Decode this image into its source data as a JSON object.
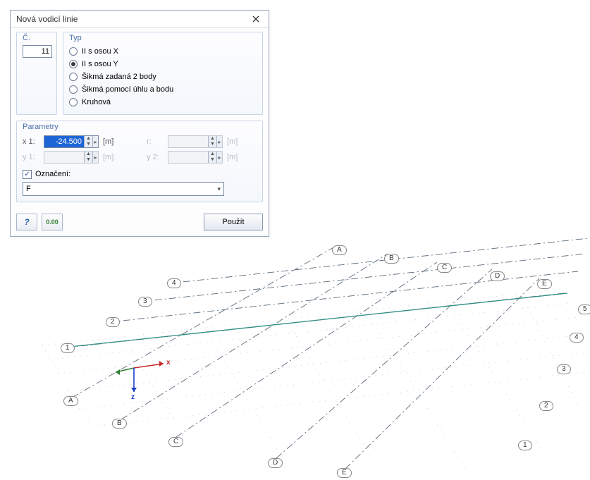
{
  "dialog": {
    "title": "Nová vodicí linie",
    "num": {
      "title": "Č.",
      "value": "11"
    },
    "type": {
      "title": "Typ",
      "options": [
        {
          "id": "opt-x",
          "label": "II s osou X",
          "checked": false
        },
        {
          "id": "opt-y",
          "label": "II s osou Y",
          "checked": true
        },
        {
          "id": "opt-2b",
          "label": "Šikmá zadaná 2 body",
          "checked": false
        },
        {
          "id": "opt-ang",
          "label": "Šikmá pomocí úhlu a bodu",
          "checked": false
        },
        {
          "id": "opt-circ",
          "label": "Kruhová",
          "checked": false
        }
      ]
    },
    "params": {
      "title": "Parametry",
      "x1": {
        "label": "x 1:",
        "value": "-24.500",
        "unit": "[m]"
      },
      "r": {
        "label": "r:",
        "value": "",
        "unit": "[m]"
      },
      "y1": {
        "label": "y 1:",
        "value": "",
        "unit": "[m]"
      },
      "y2": {
        "label": "y 2:",
        "value": "",
        "unit": "[m]"
      },
      "mark_label": "Označení:",
      "mark_checked": true,
      "mark_value": "F"
    },
    "apply_label": "Použít"
  },
  "grid": {
    "top_letters": [
      "A",
      "B",
      "C",
      "D",
      "E"
    ],
    "bottom_letters": [
      "A",
      "B",
      "C",
      "D",
      "E"
    ],
    "left_numbers": [
      "1",
      "2",
      "3",
      "4"
    ],
    "right_numbers": [
      "1",
      "2",
      "3",
      "4",
      "5"
    ],
    "axes": {
      "x": "x",
      "z": "z"
    }
  }
}
